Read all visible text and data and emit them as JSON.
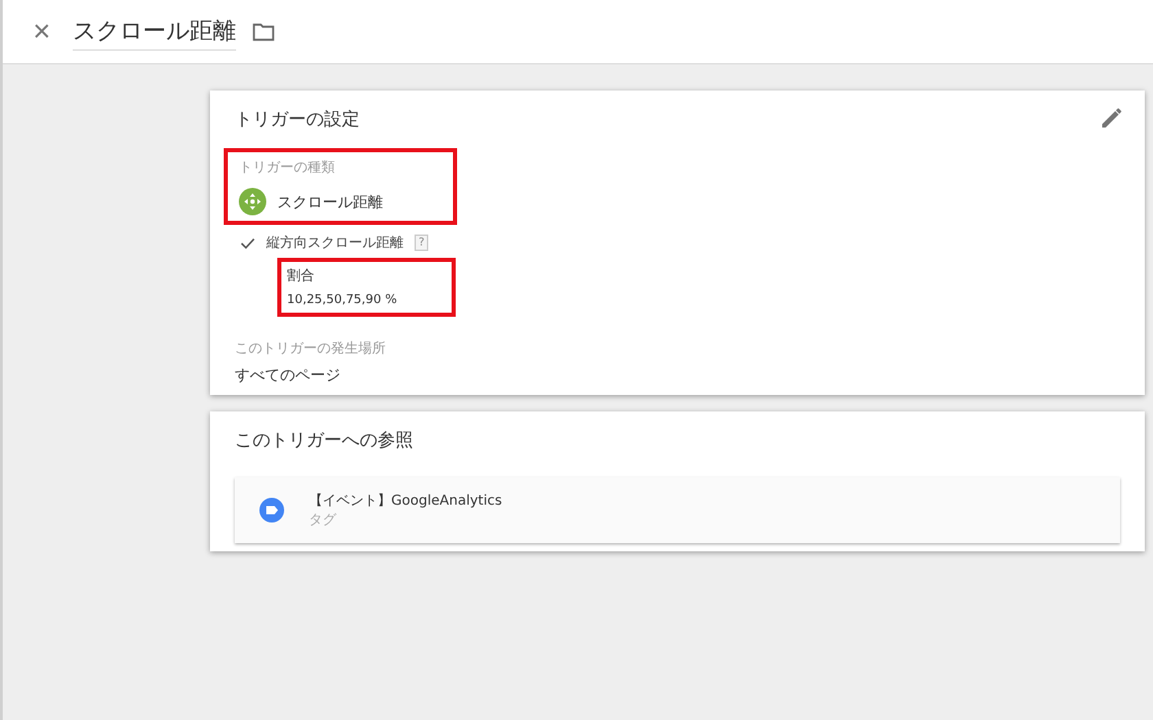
{
  "header": {
    "close": "×",
    "title": "スクロール距離"
  },
  "config_card": {
    "title": "トリガーの設定",
    "trigger_type": {
      "label": "トリガーの種類",
      "value": "スクロール距離",
      "highlighted": true
    },
    "option": {
      "checked": true,
      "label": "縦方向スクロール距離",
      "help": "?",
      "detail": {
        "label": "割合",
        "value": "10,25,50,75,90 %",
        "highlighted": true
      }
    },
    "fires_on": {
      "label": "このトリガーの発生場所",
      "value": "すべてのページ"
    }
  },
  "references_card": {
    "title": "このトリガーへの参照",
    "items": [
      {
        "name": "【イベント】GoogleAnalytics",
        "type": "タグ"
      }
    ]
  }
}
